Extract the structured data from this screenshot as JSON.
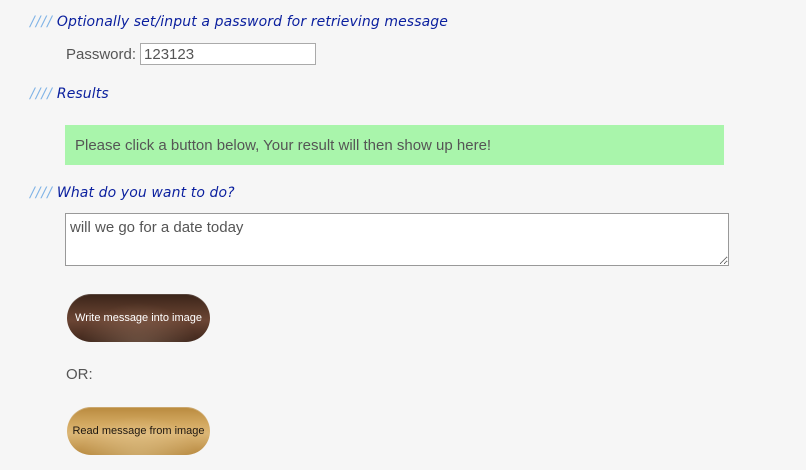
{
  "sections": {
    "password": {
      "slashes": "////",
      "title": "Optionally set/input a password for retrieving message",
      "label": "Password:",
      "value": "123123"
    },
    "results": {
      "slashes": "////",
      "title": "Results",
      "message": "Please click a button below, Your result will then show up here!",
      "background": "#a9f5ab"
    },
    "actions": {
      "slashes": "////",
      "title": "What do you want to do?",
      "message_text": "will we go for a date today",
      "write_button": "Write message into image",
      "or_label": "OR:",
      "read_button": "Read message from image"
    }
  },
  "colors": {
    "heading": "#0a1f9e",
    "slashes": "#7fb3e6",
    "page_background": "#f6f6f6"
  }
}
